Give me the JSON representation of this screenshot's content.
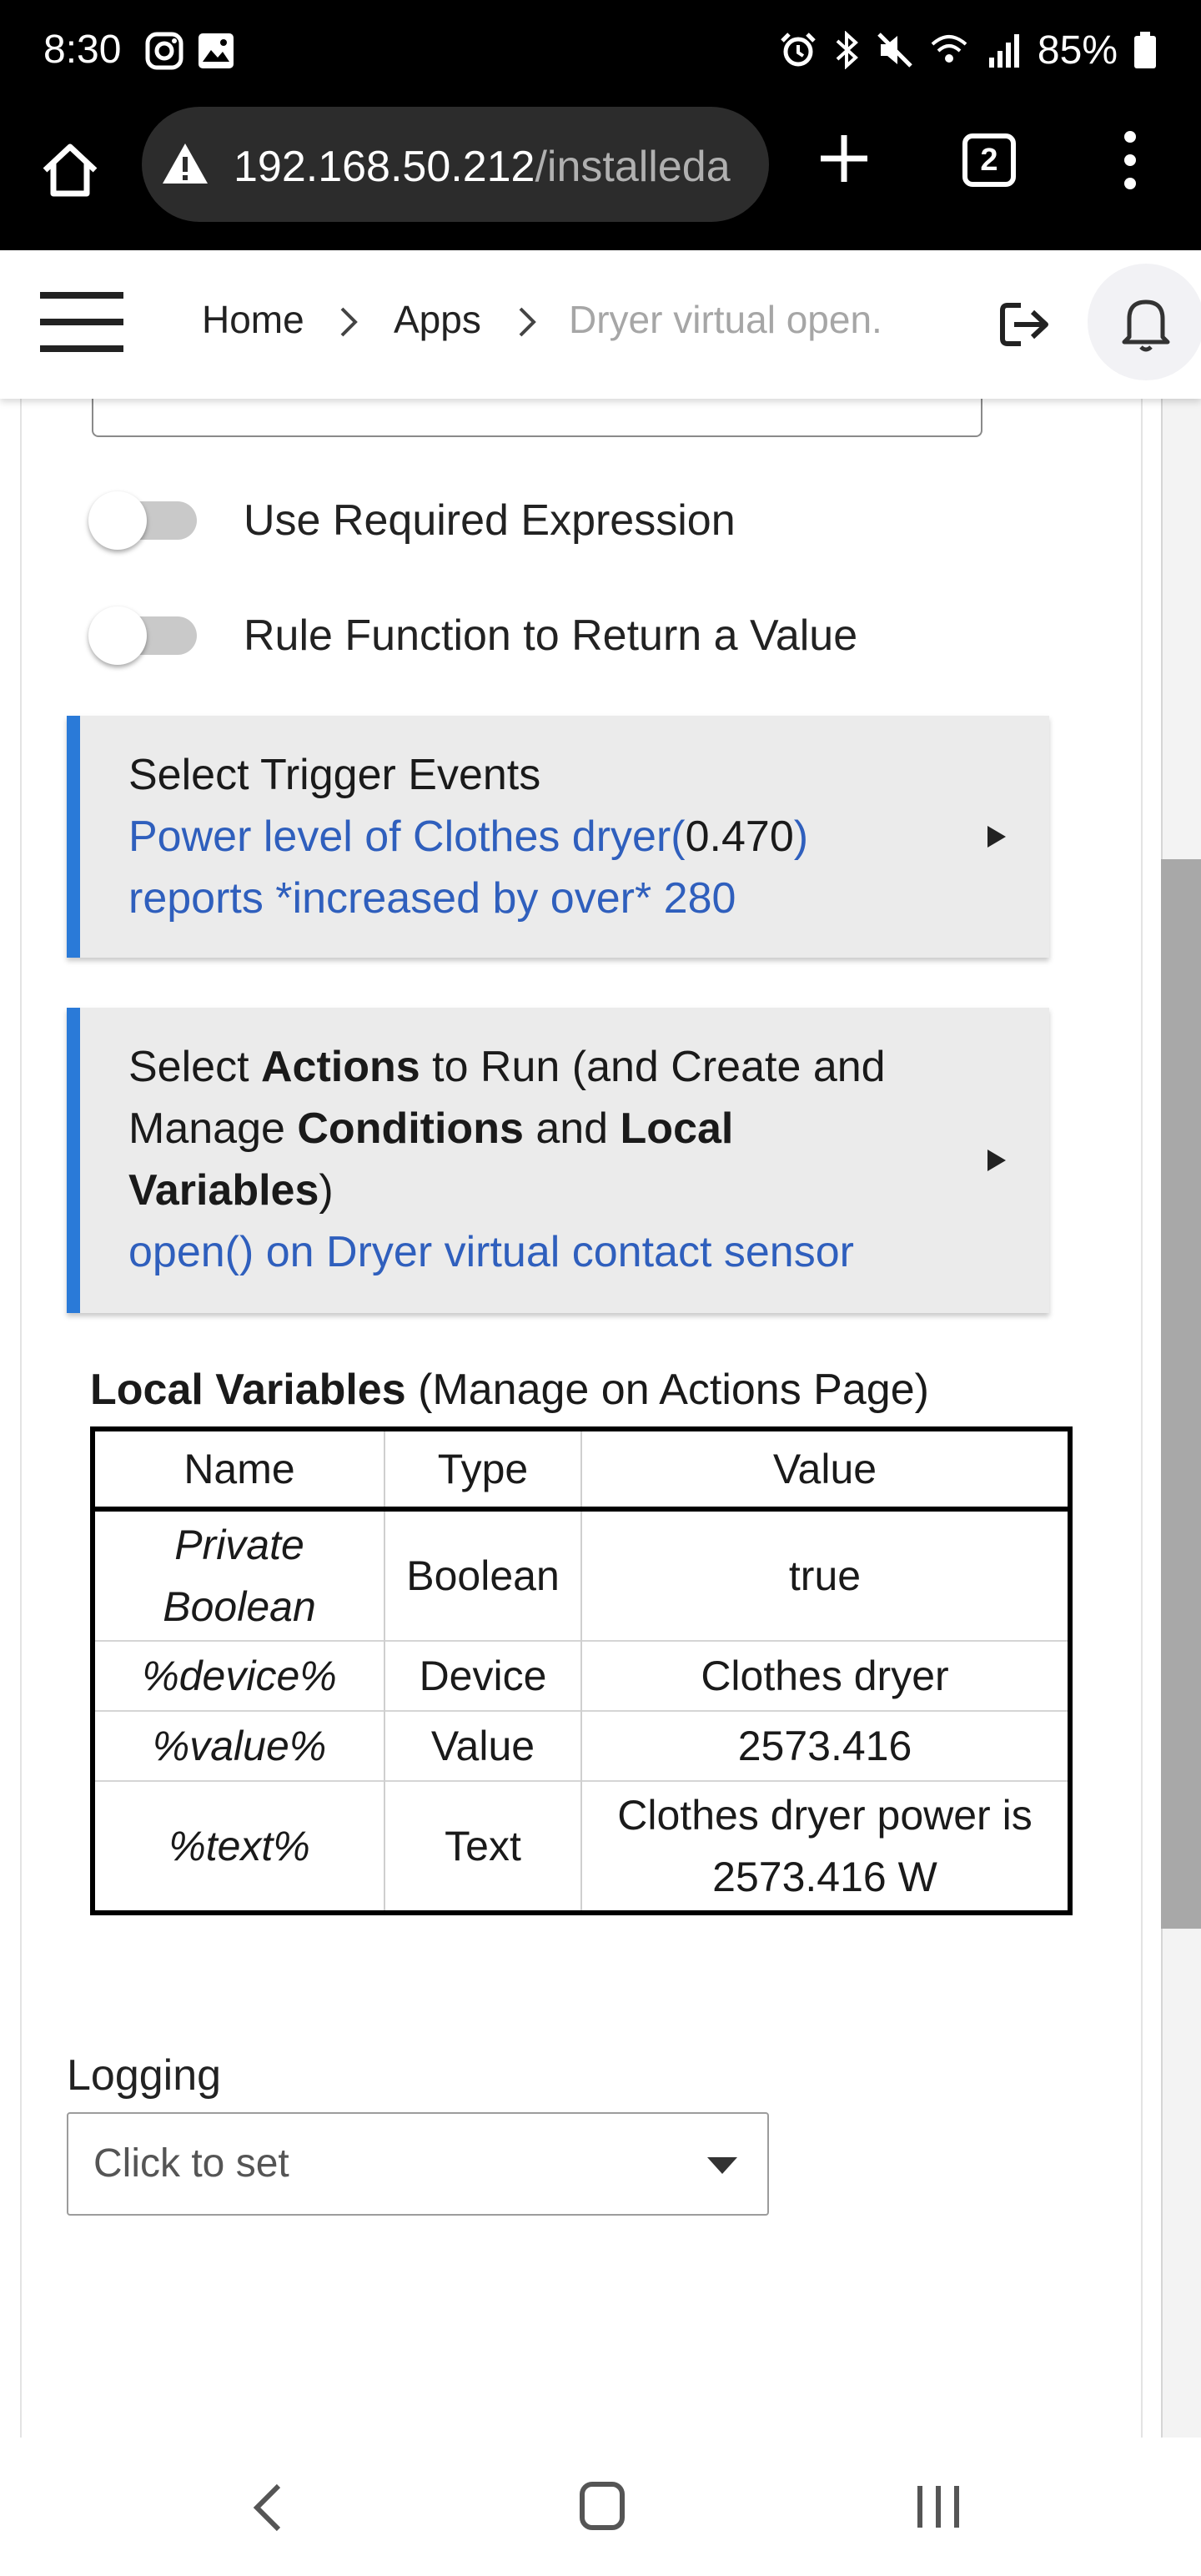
{
  "status_bar": {
    "time": "8:30",
    "battery": "85%"
  },
  "url_bar": {
    "host": "192.168.50.212",
    "path": "/installeda",
    "tab_count": "2"
  },
  "breadcrumb": {
    "items": [
      "Home",
      "Apps",
      "Dryer virtual open."
    ]
  },
  "toggles": [
    {
      "label": "Use Required Expression",
      "on": false
    },
    {
      "label": "Rule Function to Return a Value",
      "on": false
    }
  ],
  "trigger_section": {
    "title": "Select Trigger Events",
    "desc_part1": "Power level of Clothes dryer(",
    "desc_value": "0.470",
    "desc_part2": ")",
    "desc_line2": "reports *increased by over* 280"
  },
  "actions_section": {
    "t1": "Select ",
    "t2": "Actions",
    "t3": " to Run (and Create and",
    "t4": "Manage ",
    "t5": "Conditions",
    "t6": " and ",
    "t7": "Local",
    "t8": "Variables",
    "t9": ")",
    "desc": "open() on Dryer virtual contact sensor"
  },
  "local_variables": {
    "title": "Local Variables",
    "subtitle": " (Manage on Actions Page)",
    "columns": [
      "Name",
      "Type",
      "Value"
    ],
    "rows": [
      {
        "name_line1": "Private",
        "name_line2": "Boolean",
        "type": "Boolean",
        "value_line1": "true",
        "value_line2": ""
      },
      {
        "name_line1": "%device%",
        "name_line2": "",
        "type": "Device",
        "value_line1": "Clothes dryer",
        "value_line2": ""
      },
      {
        "name_line1": "%value%",
        "name_line2": "",
        "type": "Value",
        "value_line1": "2573.416",
        "value_line2": ""
      },
      {
        "name_line1": "%text%",
        "name_line2": "",
        "type": "Text",
        "value_line1": "Clothes dryer power is",
        "value_line2": "2573.416 W"
      }
    ]
  },
  "logging": {
    "label": "Logging",
    "value": "Click to set"
  },
  "colors": {
    "accent_blue": "#2a7ad8",
    "link_blue": "#2f5fbd",
    "section_bg": "#ebebeb"
  }
}
